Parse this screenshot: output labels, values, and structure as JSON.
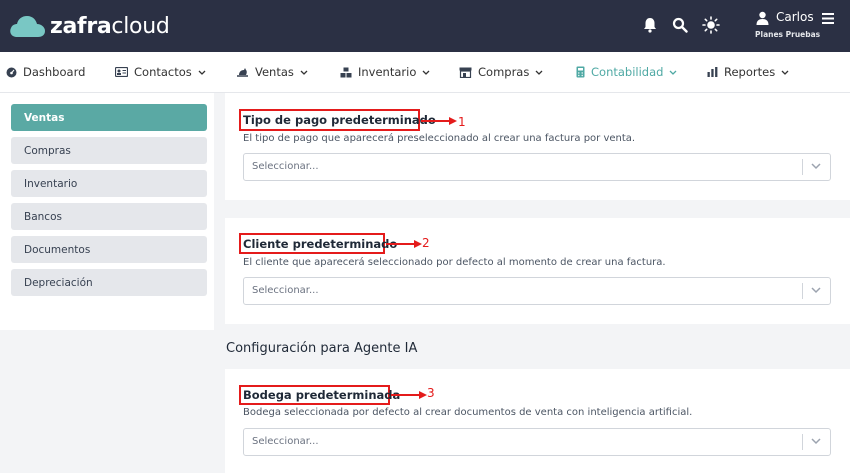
{
  "app": {
    "logo_bold": "zafra",
    "logo_light": "cloud"
  },
  "header": {
    "user_name": "Carlos",
    "user_plan": "Planes Pruebas",
    "icons": [
      "bell-icon",
      "search-icon",
      "sun-icon",
      "user-icon",
      "menu-icon"
    ]
  },
  "nav": {
    "items": [
      {
        "label": "Dashboard",
        "icon": "dashboard-icon"
      },
      {
        "label": "Contactos",
        "icon": "contacts-icon"
      },
      {
        "label": "Ventas",
        "icon": "sales-icon"
      },
      {
        "label": "Inventario",
        "icon": "inventory-icon"
      },
      {
        "label": "Compras",
        "icon": "store-icon"
      },
      {
        "label": "Contabilidad",
        "icon": "calculator-icon",
        "active": true
      },
      {
        "label": "Reportes",
        "icon": "chart-icon"
      }
    ]
  },
  "sidebar": {
    "items": [
      {
        "label": "Ventas",
        "active": true
      },
      {
        "label": "Compras"
      },
      {
        "label": "Inventario"
      },
      {
        "label": "Bancos"
      },
      {
        "label": "Documentos"
      },
      {
        "label": "Depreciación"
      }
    ]
  },
  "fields": [
    {
      "title": "Tipo de pago predeterminado",
      "description": "El tipo de pago que aparecerá preseleccionado al crear una factura por venta.",
      "placeholder": "Seleccionar...",
      "annotation": "1"
    },
    {
      "title": "Cliente predeterminado",
      "description": "El cliente que aparecerá seleccionado por defecto al momento de crear una factura.",
      "placeholder": "Seleccionar...",
      "annotation": "2"
    },
    {
      "title": "Bodega predeterminada",
      "description": "Bodega seleccionada por defecto al crear documentos de venta con inteligencia artificial.",
      "placeholder": "Seleccionar...",
      "annotation": "3"
    }
  ],
  "section": {
    "title": "Configuración para Agente IA"
  },
  "colors": {
    "header_bg": "#2b3044",
    "accent": "#5aa9a4",
    "annotation": "#e41b1b"
  }
}
